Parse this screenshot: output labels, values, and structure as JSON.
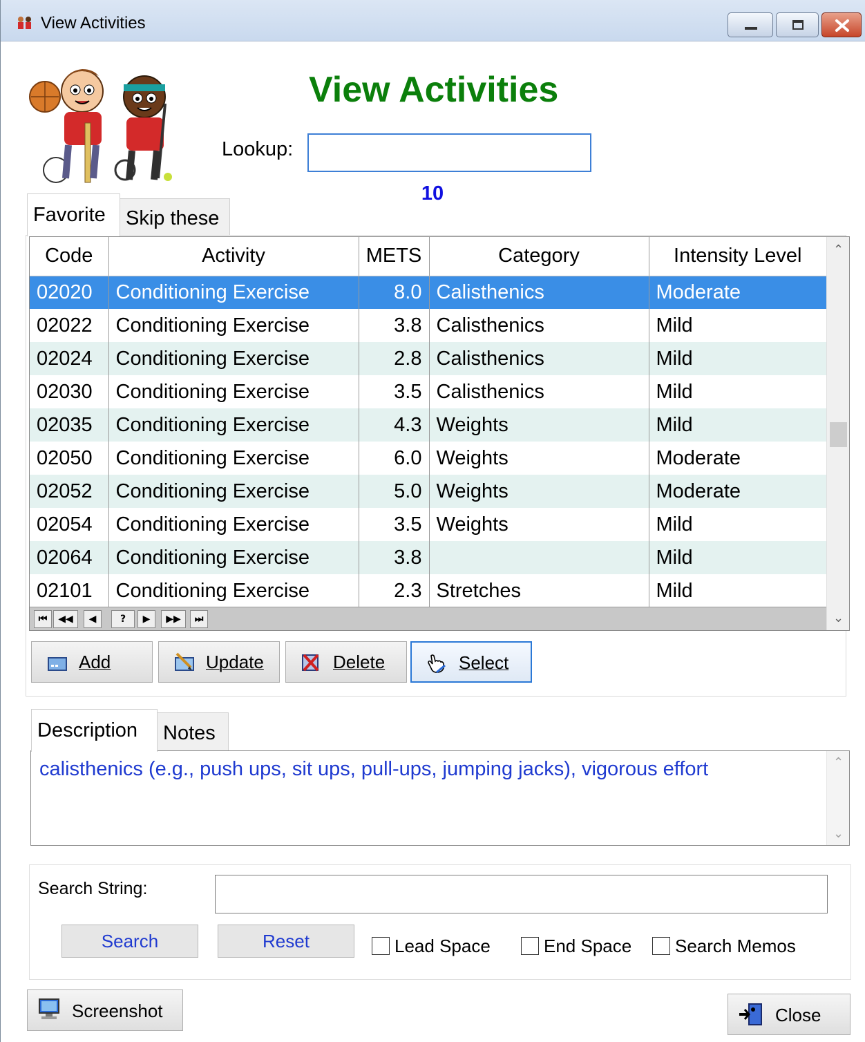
{
  "window": {
    "title": "View Activities"
  },
  "header": {
    "heading": "View Activities",
    "lookup_label": "Lookup:",
    "lookup_value": "",
    "record_count": "10"
  },
  "tabs": {
    "top": [
      "Favorite",
      "Skip these"
    ],
    "bottom": [
      "Description",
      "Notes"
    ]
  },
  "grid": {
    "columns": [
      "Code",
      "Activity",
      "METS",
      "Category",
      "Intensity Level"
    ],
    "rows": [
      [
        "02020",
        "Conditioning Exercise",
        "8.0",
        "Calisthenics",
        "Moderate"
      ],
      [
        "02022",
        "Conditioning Exercise",
        "3.8",
        "Calisthenics",
        "Mild"
      ],
      [
        "02024",
        "Conditioning Exercise",
        "2.8",
        "Calisthenics",
        "Mild"
      ],
      [
        "02030",
        "Conditioning Exercise",
        "3.5",
        "Calisthenics",
        "Mild"
      ],
      [
        "02035",
        "Conditioning Exercise",
        "4.3",
        "Weights",
        "Mild"
      ],
      [
        "02050",
        "Conditioning Exercise",
        "6.0",
        "Weights",
        "Moderate"
      ],
      [
        "02052",
        "Conditioning Exercise",
        "5.0",
        "Weights",
        "Moderate"
      ],
      [
        "02054",
        "Conditioning Exercise",
        "3.5",
        "Weights",
        "Mild"
      ],
      [
        "02064",
        "Conditioning Exercise",
        "3.8",
        "",
        "Mild"
      ],
      [
        "02101",
        "Conditioning Exercise",
        "2.3",
        "Stretches",
        "Mild"
      ]
    ],
    "selected_row": 0,
    "nav_buttons": [
      "first",
      "prev-page",
      "prev",
      "?",
      "next",
      "next-page",
      "last"
    ]
  },
  "actions": {
    "add": "Add",
    "update": "Update",
    "delete": "Delete",
    "select": "Select"
  },
  "description": {
    "text": "calisthenics (e.g., push ups, sit ups, pull-ups, jumping jacks), vigorous effort"
  },
  "search": {
    "label": "Search String:",
    "value": "",
    "search_button": "Search",
    "reset_button": "Reset",
    "lead_space": "Lead Space",
    "end_space": "End Space",
    "search_memos": "Search Memos"
  },
  "footer": {
    "screenshot": "Screenshot",
    "close": "Close"
  },
  "colors": {
    "heading": "#0b7f0b",
    "count": "#1010e0",
    "selected_row": "#3a8ee6",
    "alt_row": "#e4f2f0",
    "link_text": "#1f3ad0"
  }
}
